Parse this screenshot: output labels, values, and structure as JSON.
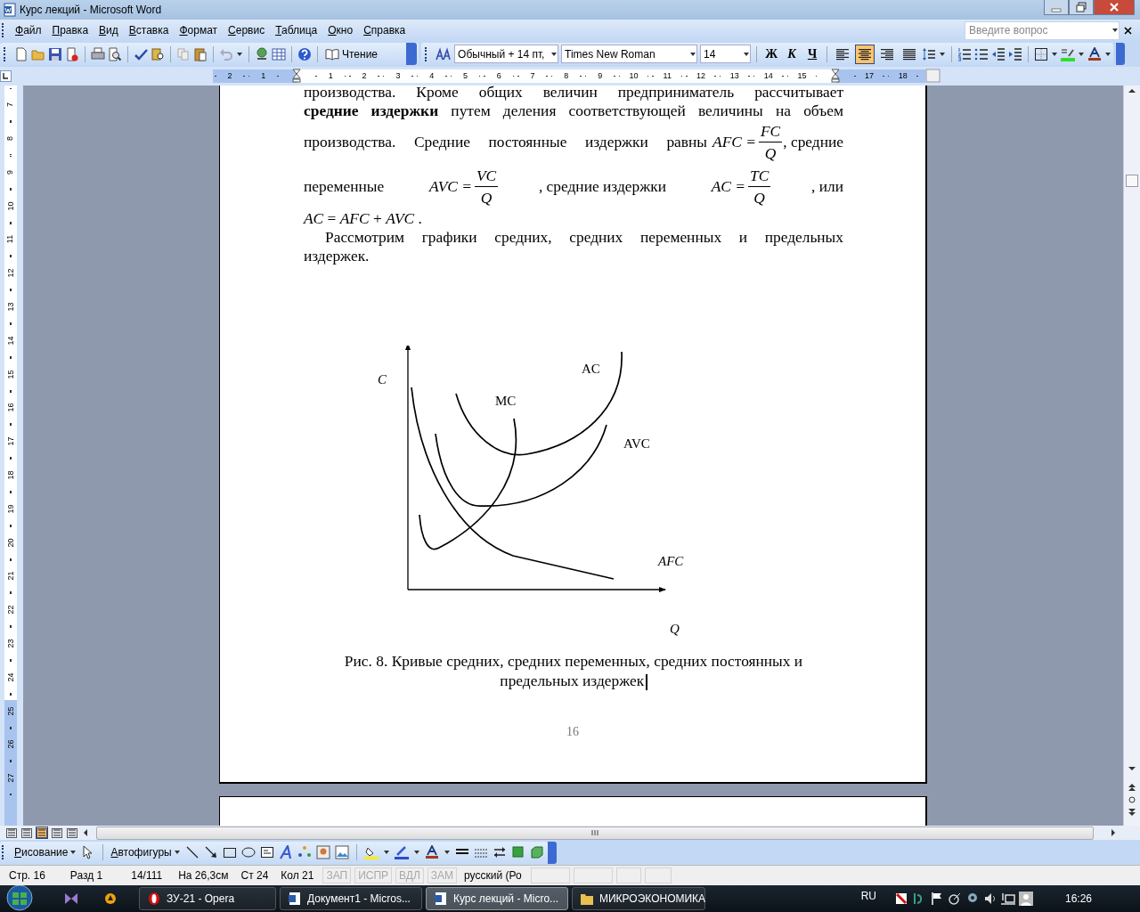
{
  "window": {
    "title": "Курс лекций - Microsoft Word"
  },
  "menu": [
    "Файл",
    "Правка",
    "Вид",
    "Вставка",
    "Формат",
    "Сервис",
    "Таблица",
    "Окно",
    "Справка"
  ],
  "help_search": {
    "placeholder": "Введите вопрос"
  },
  "standard_toolbar": {
    "reading_button": "Чтение"
  },
  "formatting_toolbar": {
    "style": "Обычный + 14 пт,",
    "font": "Times New Roman",
    "size": "14",
    "bold": "Ж",
    "italic": "К",
    "underline": "Ч",
    "alignment": [
      {
        "selected": false
      },
      {
        "selected": true
      },
      {
        "selected": false
      },
      {
        "selected": false
      }
    ]
  },
  "ruler": {
    "marks": [
      {
        "kind": "number",
        "text": "2"
      },
      {
        "kind": "number",
        "text": "1"
      },
      {
        "kind": "indent"
      },
      {
        "kind": "number",
        "text": "1"
      },
      {
        "kind": "number",
        "text": "2"
      },
      {
        "kind": "number",
        "text": "3"
      },
      {
        "kind": "number",
        "text": "4"
      },
      {
        "kind": "number",
        "text": "5"
      },
      {
        "kind": "number",
        "text": "6"
      },
      {
        "kind": "number",
        "text": "7"
      },
      {
        "kind": "number",
        "text": "8"
      },
      {
        "kind": "number",
        "text": "9"
      },
      {
        "kind": "number",
        "text": "10"
      },
      {
        "kind": "number",
        "text": "11"
      },
      {
        "kind": "number",
        "text": "12"
      },
      {
        "kind": "number",
        "text": "13"
      },
      {
        "kind": "number",
        "text": "14"
      },
      {
        "kind": "number",
        "text": "15"
      },
      {
        "kind": "indent"
      },
      {
        "kind": "number",
        "text": "17"
      },
      {
        "kind": "number",
        "text": "18"
      }
    ]
  },
  "vertical_ruler": [
    "7",
    "8",
    "9",
    "10",
    "11",
    "12",
    "13",
    "14",
    "15",
    "16",
    "17",
    "18",
    "19",
    "20",
    "21",
    "22",
    "23",
    "24",
    "25",
    "26",
    "27"
  ],
  "document": {
    "lines": [
      [
        {
          "kind": "text",
          "text": "производства.     Кроме общих величин предприниматель рассчитывает"
        }
      ],
      [
        {
          "kind": "text",
          "text": "**средние издержки** путем деления соответствующей величины на объем"
        }
      ],
      [
        {
          "kind": "text",
          "text": "производства. Средние постоянные издержки  равны"
        },
        {
          "kind": "fraction",
          "lhs": "AFC =",
          "num": "FC",
          "den": "Q"
        },
        {
          "kind": "text",
          "text": ", средние"
        }
      ],
      [
        {
          "kind": "text",
          "text": "переменные"
        },
        {
          "kind": "fraction",
          "lhs": "AVC =",
          "num": "VC",
          "den": "Q"
        },
        {
          "kind": "text",
          "text": ",  средние  издержки"
        },
        {
          "kind": "fraction",
          "lhs": "AC =",
          "num": "TC",
          "den": "Q"
        },
        {
          "kind": "text",
          "text": ",  или"
        }
      ],
      [
        {
          "kind": "left",
          "text": "*AC* = *AFC* + *AVC* ."
        }
      ],
      [
        {
          "kind": "indented",
          "text": "Рассмотрим графики средних, средних переменных и предельных"
        }
      ],
      [
        {
          "kind": "left",
          "text": "издержек."
        }
      ]
    ],
    "chart": {
      "y_axis": "C",
      "x_axis": "Q",
      "curves": [
        "AC",
        "MC",
        "AVC",
        "AFC"
      ]
    },
    "caption": [
      "Рис.  8. Кривые средних, средних переменных, средних постоянных  и",
      "предельных издержек"
    ],
    "page_number": "16"
  },
  "view_buttons": [
    {
      "selected": false
    },
    {
      "selected": false
    },
    {
      "selected": true
    },
    {
      "selected": false
    },
    {
      "selected": false
    }
  ],
  "drawing_toolbar": {
    "drawing_menu": "Рисование",
    "autoshapes_menu": "Автофигуры"
  },
  "status_bar": [
    {
      "text": "Стр. 16",
      "disabled": false
    },
    {
      "text": "Разд 1",
      "disabled": false
    },
    {
      "text": "14/111",
      "disabled": false
    },
    {
      "text": "На 26,3см",
      "disabled": false
    },
    {
      "text": "Ст 24",
      "disabled": false
    },
    {
      "text": "Кол 21",
      "disabled": false
    },
    {
      "text": "ЗАП",
      "disabled": true
    },
    {
      "text": "ИСПР",
      "disabled": true
    },
    {
      "text": "ВДЛ",
      "disabled": true
    },
    {
      "text": "ЗАМ",
      "disabled": true
    },
    {
      "text": "русский (Ро",
      "disabled": false
    }
  ],
  "taskbar": {
    "buttons": [
      {
        "label": "ЗУ-21 - Opera",
        "selected": false
      },
      {
        "label": "Документ1 - Micros...",
        "selected": false
      },
      {
        "label": "Курс лекций - Micro...",
        "selected": true
      },
      {
        "label": "МИКРОЭКОНОМИКА",
        "selected": false
      }
    ],
    "language": "RU",
    "clock": "16:26"
  }
}
